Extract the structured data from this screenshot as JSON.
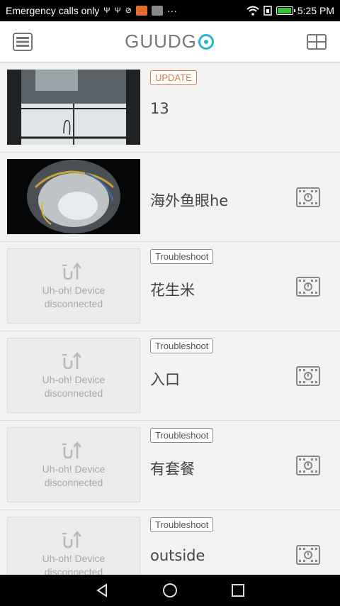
{
  "status_bar": {
    "carrier_text": "Emergency calls only",
    "extra": "···",
    "time": "5:25 PM"
  },
  "header": {
    "logo_text": "GUUDG"
  },
  "devices": [
    {
      "badge": "UPDATE",
      "name": "13",
      "status": "online",
      "thumb": "camera-feed"
    },
    {
      "badge": "",
      "name": "海外鱼眼he",
      "status": "online",
      "thumb": "fisheye-feed"
    },
    {
      "badge": "Troubleshoot",
      "name": "花生米",
      "status": "offline",
      "disc_line1": "Uh-oh! Device",
      "disc_line2": "disconnected"
    },
    {
      "badge": "Troubleshoot",
      "name": "入口",
      "status": "offline",
      "disc_line1": "Uh-oh! Device",
      "disc_line2": "disconnected"
    },
    {
      "badge": "Troubleshoot",
      "name": "有套餐",
      "status": "offline",
      "disc_line1": "Uh-oh! Device",
      "disc_line2": "disconnected"
    },
    {
      "badge": "Troubleshoot",
      "name": "outside",
      "status": "offline",
      "disc_line1": "Uh-oh! Device",
      "disc_line2": "disconnected"
    }
  ],
  "colors": {
    "accent": "#2fb3c8",
    "update_badge": "#e07a4a",
    "background": "#f2f2f2"
  }
}
